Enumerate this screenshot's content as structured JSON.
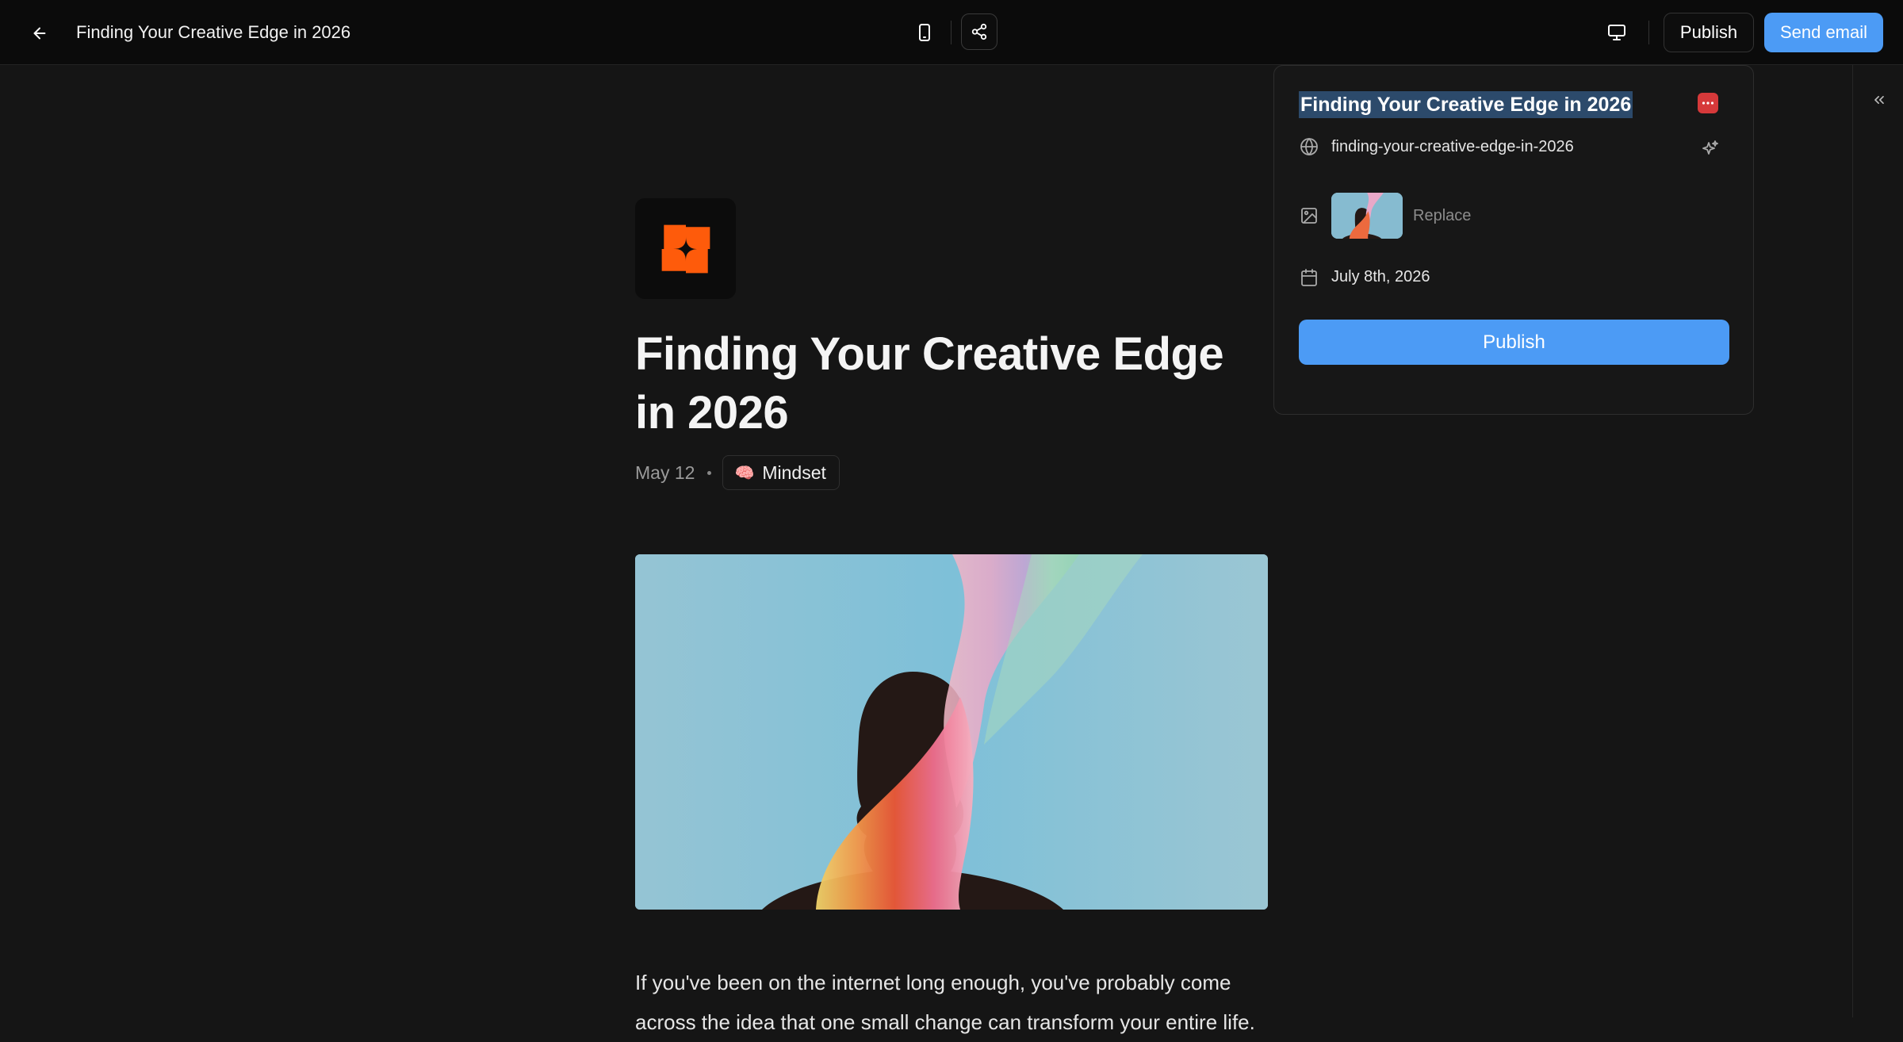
{
  "topbar": {
    "back_icon": "arrow-left-icon",
    "title": "Finding Your Creative Edge in 2026",
    "mobile_preview_icon": "smartphone-icon",
    "share_icon": "share-icon",
    "desktop_preview_icon": "monitor-icon",
    "publish_label": "Publish",
    "send_email_label": "Send email",
    "accent_color": "#4c9bf5"
  },
  "sidebar": {
    "collapse_icon": "chevrons-left-icon"
  },
  "article": {
    "logo_icon": "orange-pinwheel-logo",
    "title": "Finding Your Creative Edge in 2026",
    "date": "May 12",
    "tag": {
      "emoji": "🧠",
      "label": "Mindset"
    },
    "hero_image": "abstract-silhouette-rainbow-ribbon",
    "body_line_1": "If you've been on the internet long enough, you've probably come",
    "body_line_2": "across the idea that one small change can transform your entire life."
  },
  "popover": {
    "title_value": "Finding Your Creative Edge in 2026",
    "more_icon": "ellipsis-icon",
    "slug_icon": "globe-icon",
    "slug": "finding-your-creative-edge-in-2026",
    "ai_icon": "sparkles-icon",
    "image_icon": "image-icon",
    "replace_label": "Replace",
    "calendar_icon": "calendar-icon",
    "date": "July 8th, 2026",
    "publish_label": "Publish"
  }
}
